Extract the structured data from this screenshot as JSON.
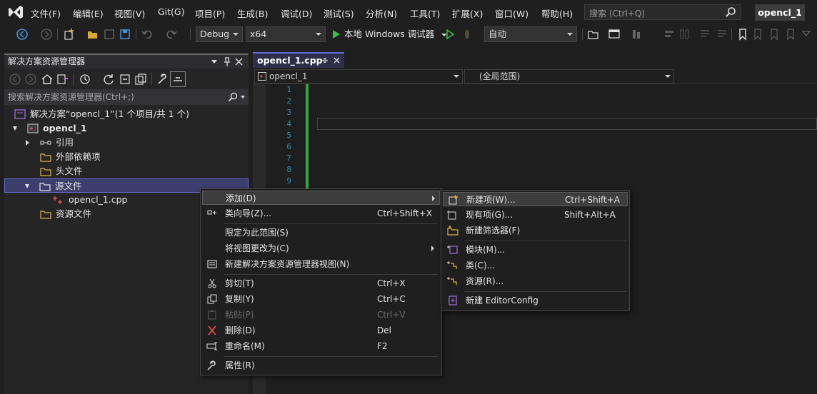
{
  "menubar": {
    "items": [
      "文件(F)",
      "编辑(E)",
      "视图(V)",
      "Git(G)",
      "项目(P)",
      "生成(B)",
      "调试(D)",
      "测试(S)",
      "分析(N)",
      "工具(T)",
      "扩展(X)",
      "窗口(W)",
      "帮助(H)"
    ],
    "search_placeholder": "搜索 (Ctrl+Q)",
    "project_name": "opencl_1"
  },
  "toolbar": {
    "config": "Debug",
    "platform": "x64",
    "run_label": "本地 Windows 调试器",
    "auto_label": "自动"
  },
  "solution_explorer": {
    "title": "解决方案资源管理器",
    "search_placeholder": "搜索解决方案资源管理器(Ctrl+;)",
    "tree": {
      "solution": "解决方案“opencl_1”(1 个项目/共 1 个)",
      "project": "opencl_1",
      "references": "引用",
      "external_deps": "外部依赖项",
      "header_files": "头文件",
      "source_files": "源文件",
      "source_file_cpp": "opencl_1.cpp",
      "resource_files": "资源文件"
    }
  },
  "editor": {
    "tab_label": "opencl_1.cpp",
    "nav_file": "opencl_1",
    "nav_scope": "(全局范围)",
    "line_numbers": [
      "1",
      "2",
      "3",
      "4",
      "5",
      "6",
      "7",
      "8",
      "9"
    ]
  },
  "context_menu": {
    "add": "添加(D)",
    "class_wizard": "类向导(Z)...",
    "class_wizard_shortcut": "Ctrl+Shift+X",
    "scope_to_this": "限定为此范围(S)",
    "change_view_to": "将视图更改为(C)",
    "new_view": "新建解决方案资源管理器视图(N)",
    "cut": "剪切(T)",
    "cut_shortcut": "Ctrl+X",
    "copy": "复制(Y)",
    "copy_shortcut": "Ctrl+C",
    "paste": "粘贴(P)",
    "paste_shortcut": "Ctrl+V",
    "delete": "删除(D)",
    "delete_shortcut": "Del",
    "rename": "重命名(M)",
    "rename_shortcut": "F2",
    "properties": "属性(R)"
  },
  "add_submenu": {
    "new_item": "新建项(W)...",
    "new_item_shortcut": "Ctrl+Shift+A",
    "existing_item": "现有项(G)...",
    "existing_item_shortcut": "Shift+Alt+A",
    "new_filter": "新建筛选器(F)",
    "module": "模块(M)...",
    "class": "类(C)...",
    "resource": "资源(R)...",
    "new_editorconfig": "新建 EditorConfig"
  },
  "colors": {
    "accent": "#6a6ae0",
    "run_green": "#3fbf4a",
    "line_number": "#2b91af"
  }
}
